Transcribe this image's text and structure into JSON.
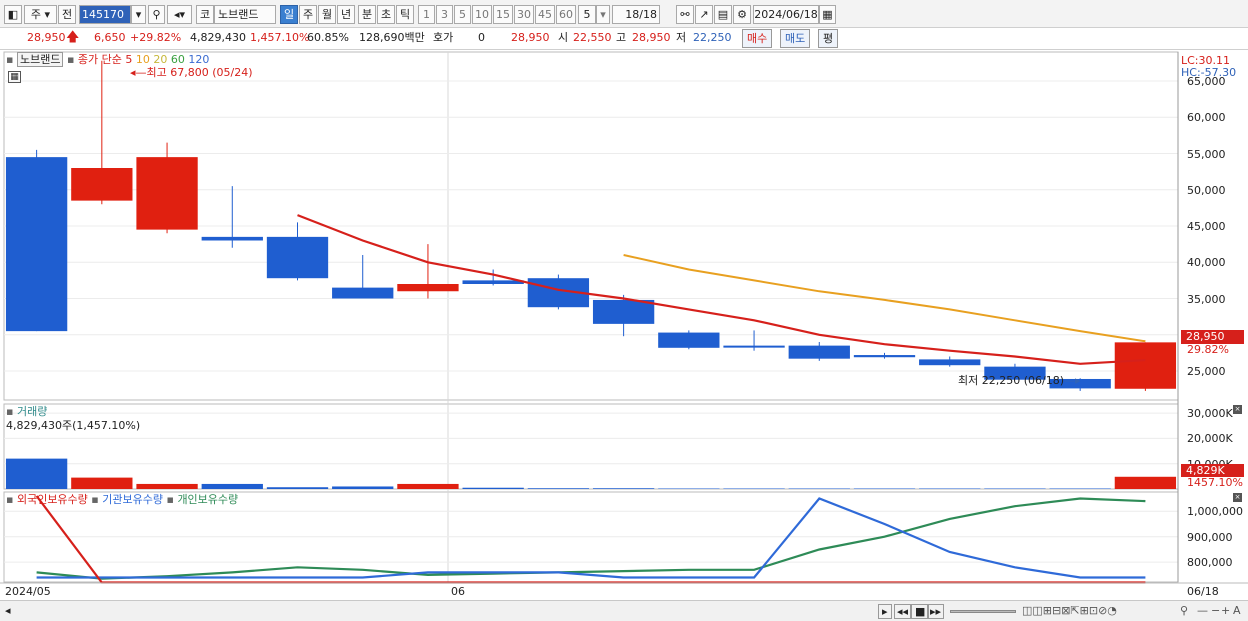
{
  "toolbar": {
    "market": "주",
    "prev": "전",
    "code": "145170",
    "market_code": "코",
    "stock_name": "노브랜드",
    "periods": [
      "일",
      "주",
      "월",
      "년",
      "분",
      "초",
      "틱"
    ],
    "selected_period": "일",
    "ticks": [
      "1",
      "3",
      "5",
      "10",
      "15",
      "30",
      "45",
      "60"
    ],
    "count": "5",
    "page": "18/18",
    "date": "2024/06/18"
  },
  "quote": {
    "price": "28,950",
    "change": "6,650",
    "change_pct": "+29.82%",
    "volume": "4,829,430",
    "volume_pct": "1,457.10%",
    "turnover": "60.85%",
    "amount": "128,690백만",
    "hoga_label": "호가",
    "hoga_value": "0",
    "ask_price": "28,950",
    "open_label": "시",
    "open": "22,550",
    "high_label": "고",
    "high": "28,950",
    "low_label": "저",
    "low": "22,250",
    "buy_label": "매수",
    "sell_label": "매도",
    "avg_label": "평"
  },
  "price_panel": {
    "stock_name": "노브랜드",
    "ma_label": "종가 단순",
    "ma_periods": [
      "5",
      "10",
      "20",
      "60",
      "120"
    ],
    "ma_colors": [
      "#d6201b",
      "#e8a020",
      "#c7b83a",
      "#3aa040",
      "#3a6ad0"
    ],
    "high_note": "최고 67,800 (05/24)",
    "low_note": "최저 22,250 (06/18)",
    "lc": "LC:30.11",
    "hc": "HC:-57.30",
    "y_ticks": [
      "65,000",
      "60,000",
      "55,000",
      "50,000",
      "45,000",
      "40,000",
      "35,000",
      "30,000",
      "25,000"
    ],
    "last_price": "28,950",
    "last_pct": "29.82%"
  },
  "volume_panel": {
    "title": "거래량",
    "note": "4,829,430주(1,457.10%)",
    "y_ticks": [
      "30,000K",
      "20,000K",
      "10,000K"
    ],
    "last": "4,829K",
    "last_pct": "1457.10%"
  },
  "holders_panel": {
    "series": [
      "외국인보유수량",
      "기관보유수량",
      "개인보유수량"
    ],
    "colors": [
      "#d6201b",
      "#2f6ad8",
      "#2e8b57"
    ],
    "y_ticks": [
      "1,000,000",
      "900,000",
      "800,000"
    ]
  },
  "x_axis": {
    "labels": [
      "2024/05",
      "06",
      "06/18"
    ]
  },
  "chart_data": {
    "type": "candlestick",
    "candles": [
      {
        "o": 54500,
        "h": 55500,
        "l": 30500,
        "c": 30500
      },
      {
        "o": 48500,
        "h": 67800,
        "l": 48000,
        "c": 53000
      },
      {
        "o": 44500,
        "h": 56500,
        "l": 44000,
        "c": 54500
      },
      {
        "o": 43500,
        "h": 50500,
        "l": 42000,
        "c": 43000
      },
      {
        "o": 43500,
        "h": 45500,
        "l": 37500,
        "c": 37800
      },
      {
        "o": 36500,
        "h": 41000,
        "l": 35000,
        "c": 35000
      },
      {
        "o": 36000,
        "h": 42500,
        "l": 35000,
        "c": 37000
      },
      {
        "o": 37500,
        "h": 39000,
        "l": 36800,
        "c": 37000
      },
      {
        "o": 37800,
        "h": 38300,
        "l": 33500,
        "c": 33800
      },
      {
        "o": 34800,
        "h": 35500,
        "l": 29800,
        "c": 31500
      },
      {
        "o": 30300,
        "h": 30600,
        "l": 28000,
        "c": 28200
      },
      {
        "o": 28500,
        "h": 30600,
        "l": 27800,
        "c": 28300
      },
      {
        "o": 28500,
        "h": 29000,
        "l": 26400,
        "c": 26700
      },
      {
        "o": 27200,
        "h": 27500,
        "l": 26700,
        "c": 26900
      },
      {
        "o": 26600,
        "h": 27000,
        "l": 25600,
        "c": 25800
      },
      {
        "o": 25600,
        "h": 26000,
        "l": 23800,
        "c": 23800
      },
      {
        "o": 23900,
        "h": 24000,
        "l": 22250,
        "c": 22600
      },
      {
        "o": 22550,
        "h": 28950,
        "l": 22250,
        "c": 28950
      }
    ],
    "ma5": [
      null,
      null,
      null,
      null,
      46500,
      43000,
      40000,
      38300,
      36200,
      35000,
      33500,
      32000,
      30000,
      28700,
      27800,
      27000,
      26000,
      26500
    ],
    "ma10": [
      null,
      null,
      null,
      null,
      null,
      null,
      null,
      null,
      null,
      41000,
      39000,
      37500,
      36000,
      34800,
      33500,
      32000,
      30500,
      29100
    ],
    "volume_k": [
      12000,
      4500,
      2000,
      2000,
      700,
      1000,
      2000,
      500,
      300,
      300,
      200,
      200,
      200,
      200,
      200,
      200,
      200,
      4829
    ],
    "foreign": [
      1200000,
      720000,
      720000,
      720000,
      720000,
      720000,
      720000,
      720000,
      720000,
      720000,
      720000,
      720000,
      720000,
      720000,
      720000,
      720000,
      720000,
      720000
    ],
    "institution": [
      740000,
      740000,
      740000,
      740000,
      740000,
      740000,
      760000,
      760000,
      760000,
      740000,
      740000,
      740000,
      1050000,
      950000,
      840000,
      780000,
      740000,
      740000
    ],
    "individual": [
      760000,
      735000,
      745000,
      760000,
      780000,
      770000,
      750000,
      755000,
      760000,
      765000,
      770000,
      770000,
      850000,
      900000,
      970000,
      1020000,
      1050000,
      1040000
    ],
    "y_range_price": [
      21000,
      69000
    ],
    "y_range_volume_k": [
      0,
      32000
    ],
    "y_range_holders": [
      730000,
      1060000
    ]
  }
}
